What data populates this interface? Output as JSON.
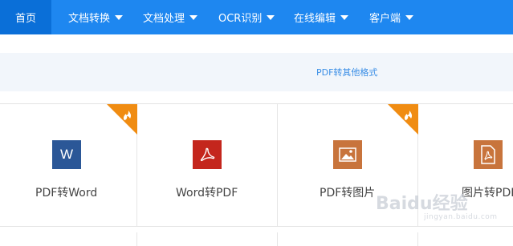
{
  "nav": {
    "home": "首页",
    "items": [
      {
        "label": "文档转换"
      },
      {
        "label": "文档处理"
      },
      {
        "label": "OCR识别"
      },
      {
        "label": "在线编辑"
      },
      {
        "label": "客户端"
      }
    ]
  },
  "band": {
    "link": "PDF转其他格式"
  },
  "cards": [
    {
      "label": "PDF转Word",
      "icon": "word-icon",
      "hot": true
    },
    {
      "label": "Word转PDF",
      "icon": "pdf-icon",
      "hot": false
    },
    {
      "label": "PDF转图片",
      "icon": "image-icon",
      "hot": true
    },
    {
      "label": "图片转PDF",
      "icon": "image-to-pdf-icon",
      "hot": false
    }
  ],
  "watermark": {
    "text": "Baidu经验",
    "sub": "jingyan.baidu.com"
  },
  "colors": {
    "nav": "#1e87f0",
    "nav_active": "#0a6fd8",
    "hot_badge": "#f08c12",
    "word": "#2b5797",
    "pdf": "#c4261d",
    "image": "#c8743c"
  }
}
